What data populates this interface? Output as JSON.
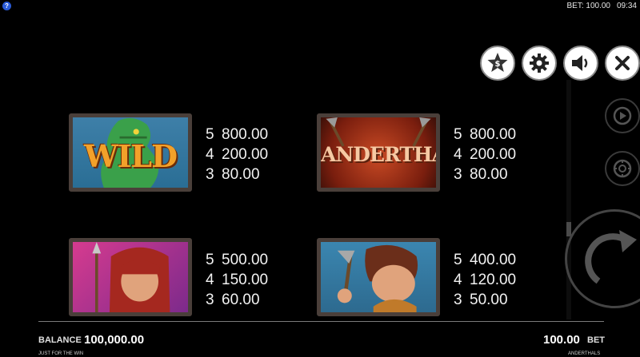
{
  "status": {
    "bet": "BET: 100.00",
    "time": "09:34"
  },
  "buttons": {
    "cashier_icon": "dollar-star-icon",
    "settings_icon": "gear-icon",
    "sound_icon": "speaker-icon",
    "close_icon": "close-icon",
    "autoplay_icon": "autoplay-icon",
    "coin_icon": "coin-icon",
    "spin_icon": "spin-arrow-icon"
  },
  "symbols": [
    {
      "id": "wild",
      "label": "WILD",
      "pays": [
        {
          "count": "5",
          "amount": "800.00"
        },
        {
          "count": "4",
          "amount": "200.00"
        },
        {
          "count": "3",
          "amount": "80.00"
        }
      ]
    },
    {
      "id": "logo",
      "label": "ANDERTHALS",
      "pays": [
        {
          "count": "5",
          "amount": "800.00"
        },
        {
          "count": "4",
          "amount": "200.00"
        },
        {
          "count": "3",
          "amount": "80.00"
        }
      ]
    },
    {
      "id": "woman",
      "pays": [
        {
          "count": "5",
          "amount": "500.00"
        },
        {
          "count": "4",
          "amount": "150.00"
        },
        {
          "count": "3",
          "amount": "60.00"
        }
      ]
    },
    {
      "id": "man",
      "pays": [
        {
          "count": "5",
          "amount": "400.00"
        },
        {
          "count": "4",
          "amount": "120.00"
        },
        {
          "count": "3",
          "amount": "50.00"
        }
      ]
    }
  ],
  "footer": {
    "balance_label": "BALANCE",
    "balance_value": "100,000.00",
    "bet_value": "100.00",
    "bet_label": "BET",
    "brand_left": "JUST FOR THE WIN",
    "brand_right": "ANDERTHALS"
  },
  "colors": {
    "background": "#000000",
    "frame": "#4a3f3a",
    "accent": "#2a5bd7"
  }
}
